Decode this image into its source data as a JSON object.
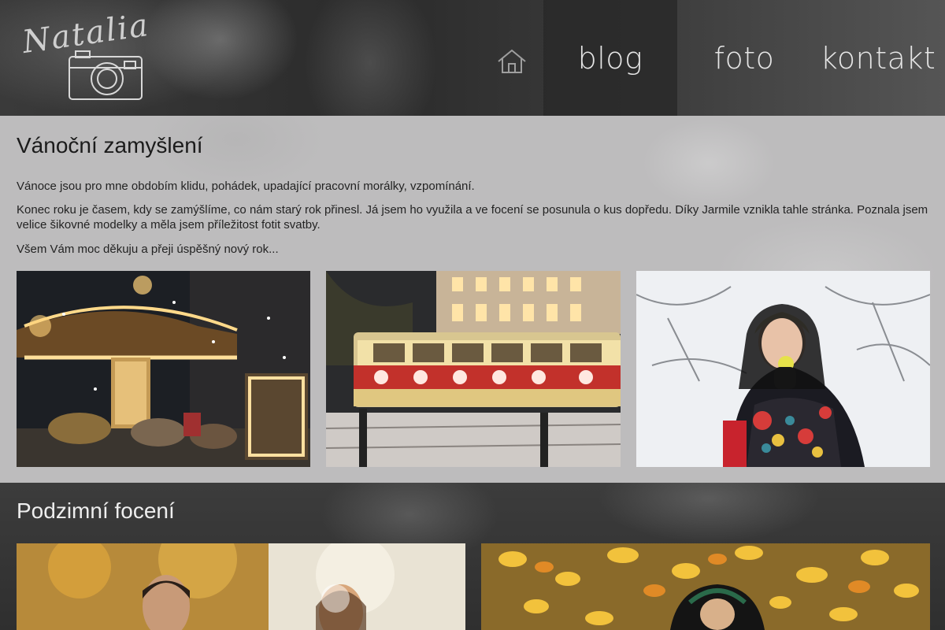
{
  "header": {
    "logo_text": "Natalia",
    "nav": {
      "home_icon": "home-icon",
      "blog": "blog",
      "foto": "foto",
      "kontakt": "kontakt"
    }
  },
  "posts": [
    {
      "title": "Vánoční zamyšlení",
      "paragraphs": [
        "Vánoce jsou pro mne obdobím klidu, pohádek, upadající pracovní morálky, vzpomínání.",
        "Konec roku je časem, kdy se zamýšlíme, co nám starý rok přinesl. Já jsem ho využila a ve focení se posunula o kus dopředu. Díky Jarmile vznikla tahle stránka. Poznala jsem velice šikovné modelky a měla jsem příležitost fotit svatby.",
        "Všem Vám moc děkuju a přeji úspěšný nový rok..."
      ],
      "photos": [
        "carousel-photo",
        "tram-photo",
        "snow-portrait-photo"
      ]
    },
    {
      "title": "Podzimní focení",
      "photos": [
        "couple-autumn-photo",
        "autumn-leaves-portrait-photo"
      ]
    }
  ]
}
